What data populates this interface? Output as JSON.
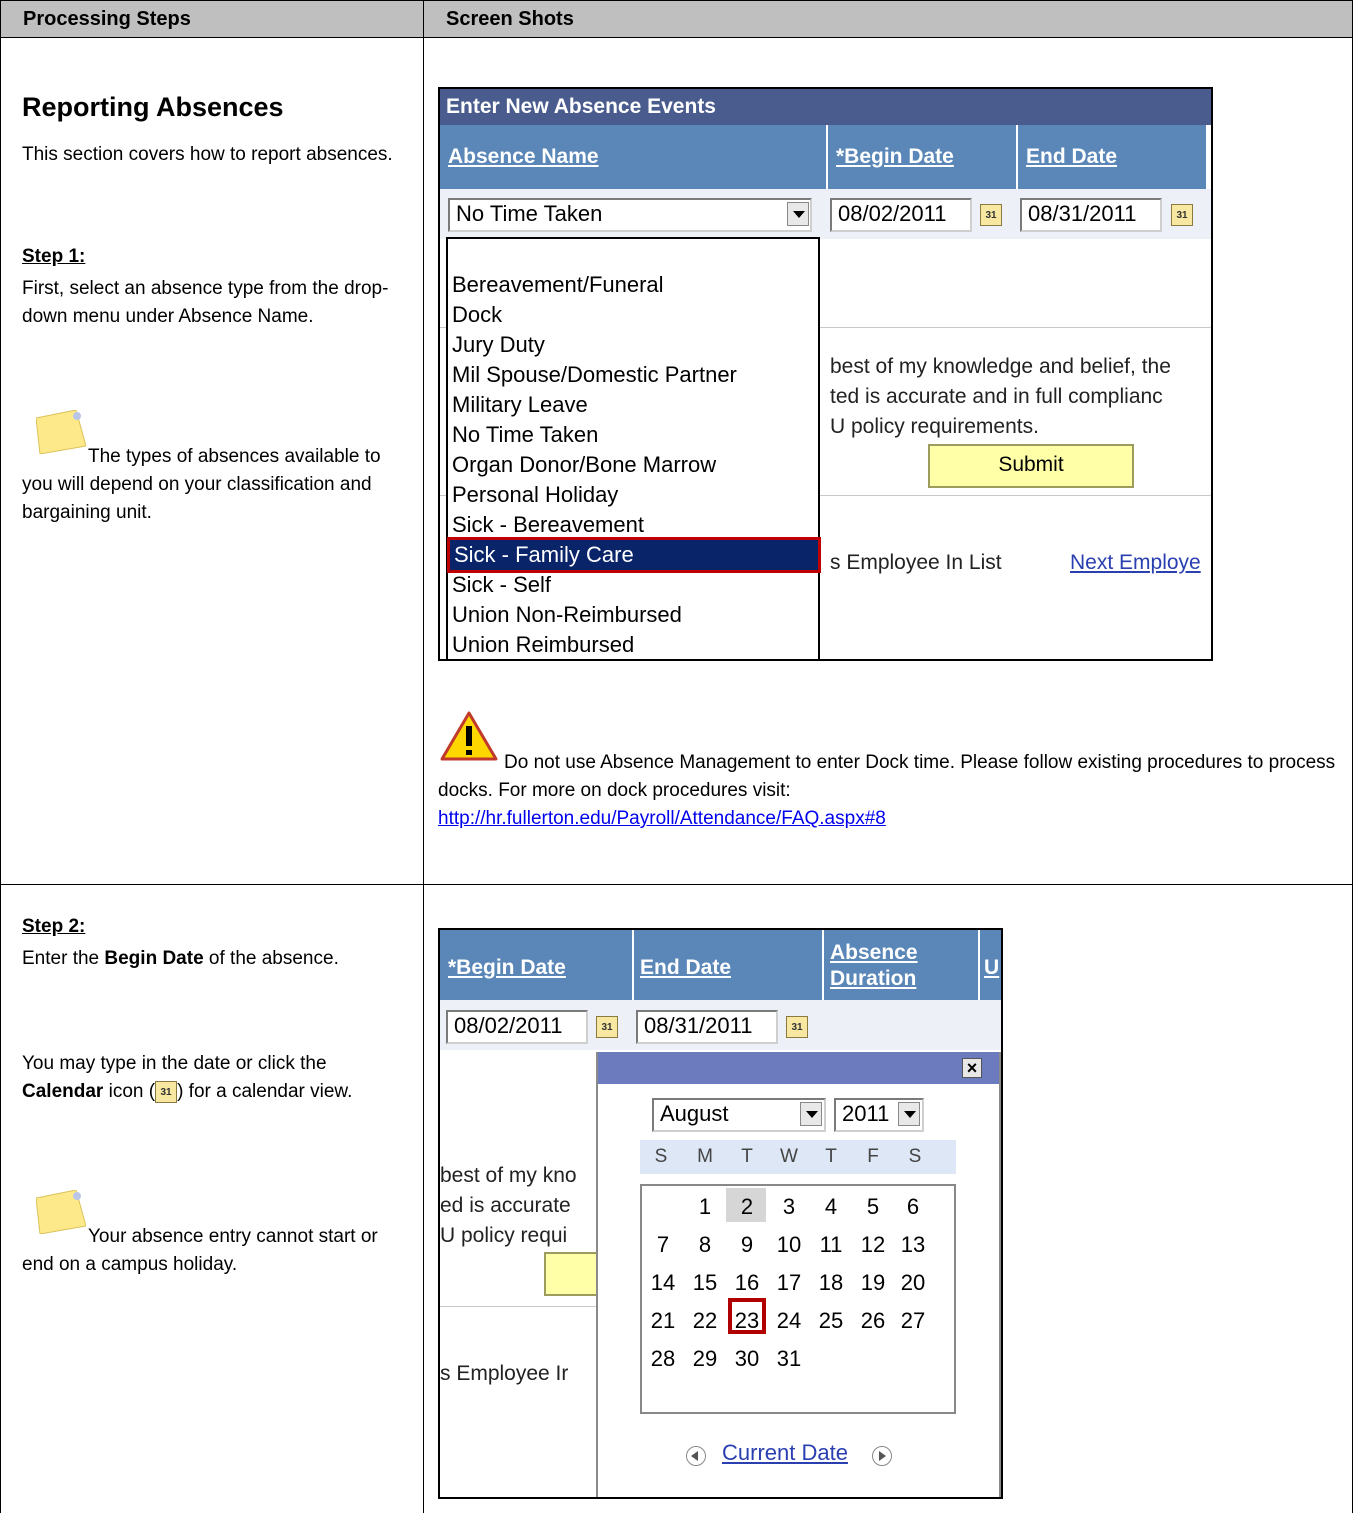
{
  "header": {
    "col1": "Processing Steps",
    "col2": "Screen Shots"
  },
  "section1": {
    "title": "Reporting Absences",
    "intro": "This section covers how to report absences.",
    "step_label": "Step 1:",
    "step_text": "First, select an absence type from the drop-down menu under Absence Name.",
    "note_text": "The types of absences available to you will depend on your classification and bargaining unit."
  },
  "shot1": {
    "title": "Enter New Absence Events",
    "columns": [
      "Absence Name",
      "*Begin Date",
      "End Date"
    ],
    "selected_value": "No Time Taken",
    "begin_date": "08/02/2011",
    "end_date": "08/31/2011",
    "calendar_glyph": "31",
    "options": [
      "Bereavement/Funeral",
      "Dock",
      "Jury Duty",
      "Mil Spouse/Domestic Partner",
      "Military Leave",
      "No Time Taken",
      "Organ Donor/Bone Marrow",
      "Personal Holiday",
      "Sick - Bereavement",
      "Sick - Family Care",
      "Sick - Self",
      "Union Non-Reimbursed",
      "Union Reimbursed"
    ],
    "highlighted_option": "Sick - Family Care",
    "cert_lines": [
      "best of my knowledge and belief, the",
      "ted is accurate and in full complianc",
      "U policy requirements."
    ],
    "submit_label": "Submit",
    "prev_fragment": "s Employee In List",
    "next_link": "Next Employe"
  },
  "warning": {
    "text": "Do not use Absence Management to enter Dock time. Please follow existing procedures to process docks. For more on dock procedures visit:",
    "link": "http://hr.fullerton.edu/Payroll/Attendance/FAQ.aspx#8"
  },
  "section2": {
    "step_label": "Step 2:",
    "l1a": "Enter the ",
    "l1b": "Begin Date",
    "l1c": " of the absence.",
    "l2a": "You may type in the date or click the ",
    "l2b": "Calendar",
    "l2c": " icon (",
    "l2d": ") for a calendar view.",
    "note_text": "Your absence entry cannot start or end on a campus holiday."
  },
  "shot2": {
    "columns": [
      "*Begin Date",
      "End Date",
      "Absence Duration",
      "U"
    ],
    "begin_date": "08/02/2011",
    "end_date": "08/31/2011",
    "month": "August",
    "year": "2011",
    "weekdays": [
      "S",
      "M",
      "T",
      "W",
      "T",
      "F",
      "S"
    ],
    "weeks": [
      [
        "",
        "1",
        "2",
        "3",
        "4",
        "5",
        "6"
      ],
      [
        "7",
        "8",
        "9",
        "10",
        "11",
        "12",
        "13"
      ],
      [
        "14",
        "15",
        "16",
        "17",
        "18",
        "19",
        "20"
      ],
      [
        "21",
        "22",
        "23",
        "24",
        "25",
        "26",
        "27"
      ],
      [
        "28",
        "29",
        "30",
        "31",
        "",
        "",
        ""
      ]
    ],
    "current_day": "2",
    "selected_day": "23",
    "current_date_link": "Current Date",
    "cert_fragments": [
      "best of my kno",
      "ed is accurate",
      "U policy requi"
    ],
    "prev_fragment": "s Employee Ir"
  }
}
